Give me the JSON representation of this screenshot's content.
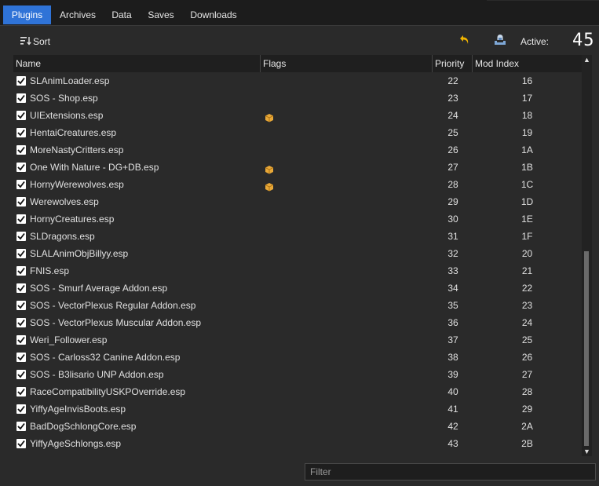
{
  "tabs": [
    {
      "label": "Plugins",
      "active": true
    },
    {
      "label": "Archives",
      "active": false
    },
    {
      "label": "Data",
      "active": false
    },
    {
      "label": "Saves",
      "active": false
    },
    {
      "label": "Downloads",
      "active": false
    }
  ],
  "toolbar": {
    "sort_label": "Sort",
    "sort_icon": "sort-icon",
    "undo_icon": "undo-arrow-icon",
    "save_icon": "save-profile-icon",
    "active_label": "Active:",
    "active_count": "45"
  },
  "table": {
    "columns": [
      "Name",
      "Flags",
      "Priority",
      "Mod Index"
    ],
    "rows": [
      {
        "name": "SLAnimLoader.esp",
        "flag": false,
        "priority": "22",
        "mod_index": "16"
      },
      {
        "name": "SOS - Shop.esp",
        "flag": false,
        "priority": "23",
        "mod_index": "17"
      },
      {
        "name": "UIExtensions.esp",
        "flag": true,
        "priority": "24",
        "mod_index": "18"
      },
      {
        "name": "HentaiCreatures.esp",
        "flag": false,
        "priority": "25",
        "mod_index": "19"
      },
      {
        "name": "MoreNastyCritters.esp",
        "flag": false,
        "priority": "26",
        "mod_index": "1A"
      },
      {
        "name": "One With Nature - DG+DB.esp",
        "flag": true,
        "priority": "27",
        "mod_index": "1B"
      },
      {
        "name": "HornyWerewolves.esp",
        "flag": true,
        "priority": "28",
        "mod_index": "1C"
      },
      {
        "name": "Werewolves.esp",
        "flag": false,
        "priority": "29",
        "mod_index": "1D"
      },
      {
        "name": "HornyCreatures.esp",
        "flag": false,
        "priority": "30",
        "mod_index": "1E"
      },
      {
        "name": "SLDragons.esp",
        "flag": false,
        "priority": "31",
        "mod_index": "1F"
      },
      {
        "name": "SLALAnimObjBillyy.esp",
        "flag": false,
        "priority": "32",
        "mod_index": "20"
      },
      {
        "name": "FNIS.esp",
        "flag": false,
        "priority": "33",
        "mod_index": "21"
      },
      {
        "name": "SOS - Smurf Average Addon.esp",
        "flag": false,
        "priority": "34",
        "mod_index": "22"
      },
      {
        "name": "SOS - VectorPlexus Regular Addon.esp",
        "flag": false,
        "priority": "35",
        "mod_index": "23"
      },
      {
        "name": "SOS - VectorPlexus Muscular Addon.esp",
        "flag": false,
        "priority": "36",
        "mod_index": "24"
      },
      {
        "name": "Weri_Follower.esp",
        "flag": false,
        "priority": "37",
        "mod_index": "25"
      },
      {
        "name": "SOS - Carloss32 Canine Addon.esp",
        "flag": false,
        "priority": "38",
        "mod_index": "26"
      },
      {
        "name": "SOS - B3lisario UNP Addon.esp",
        "flag": false,
        "priority": "39",
        "mod_index": "27"
      },
      {
        "name": "RaceCompatibilityUSKPOverride.esp",
        "flag": false,
        "priority": "40",
        "mod_index": "28"
      },
      {
        "name": "YiffyAgeInvisBoots.esp",
        "flag": false,
        "priority": "41",
        "mod_index": "29"
      },
      {
        "name": "BadDogSchlongCore.esp",
        "flag": false,
        "priority": "42",
        "mod_index": "2A"
      },
      {
        "name": "YiffyAgeSchlongs.esp",
        "flag": false,
        "priority": "43",
        "mod_index": "2B"
      }
    ],
    "flag_icon": "package-icon"
  },
  "filter": {
    "placeholder": "Filter",
    "value": ""
  },
  "colors": {
    "accent": "#2f73d7",
    "background": "#2a2a2a",
    "header": "#1f1f1f",
    "flag": "#e8a838"
  }
}
